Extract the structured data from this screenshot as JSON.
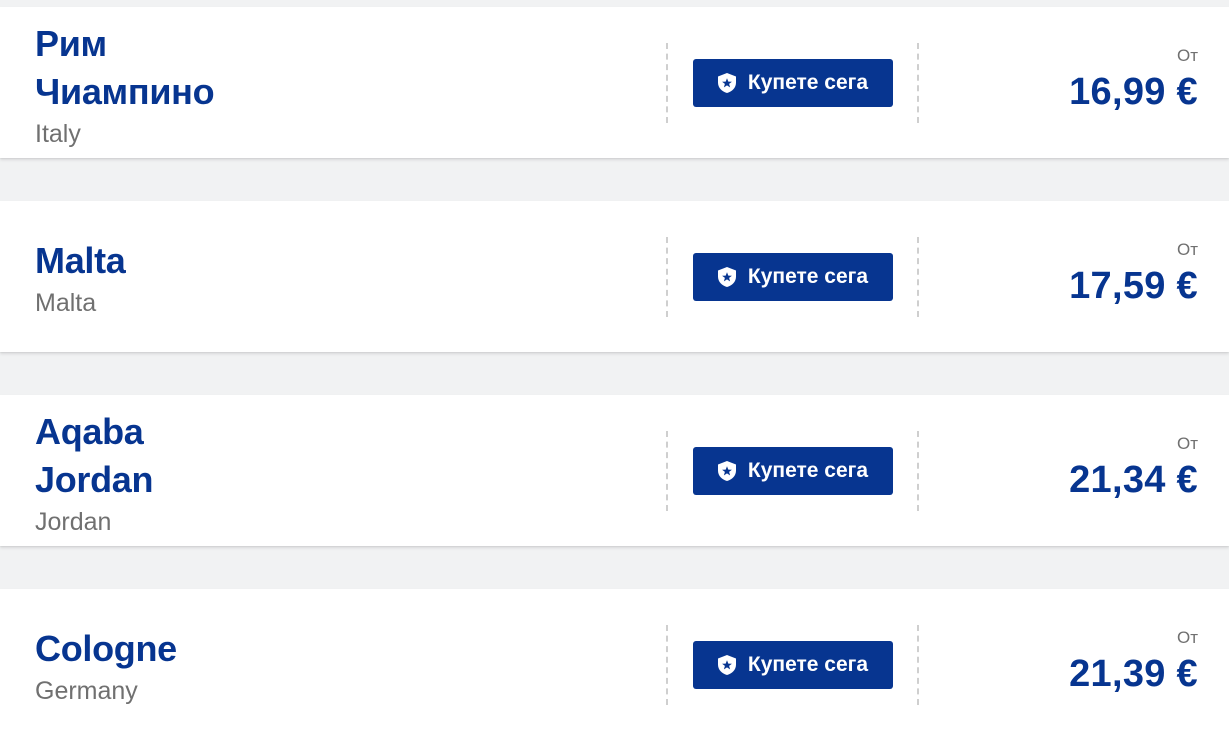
{
  "colors": {
    "brand_blue": "#073590",
    "muted_text": "#707070",
    "background": "#f1f2f3"
  },
  "flights": [
    {
      "city_lines": [
        "Рим",
        "Чиампино"
      ],
      "country": "Italy",
      "button_label": "Купете сега",
      "button_icon": "shield-star-icon",
      "from_label": "От",
      "price": "16,99 €"
    },
    {
      "city_lines": [
        "Malta"
      ],
      "country": "Malta",
      "button_label": "Купете сега",
      "button_icon": "shield-star-icon",
      "from_label": "От",
      "price": "17,59 €"
    },
    {
      "city_lines": [
        "Aqaba",
        "Jordan"
      ],
      "country": "Jordan",
      "button_label": "Купете сега",
      "button_icon": "shield-star-icon",
      "from_label": "От",
      "price": "21,34 €"
    },
    {
      "city_lines": [
        "Cologne"
      ],
      "country": "Germany",
      "button_label": "Купете сега",
      "button_icon": "shield-star-icon",
      "from_label": "От",
      "price": "21,39 €"
    }
  ]
}
